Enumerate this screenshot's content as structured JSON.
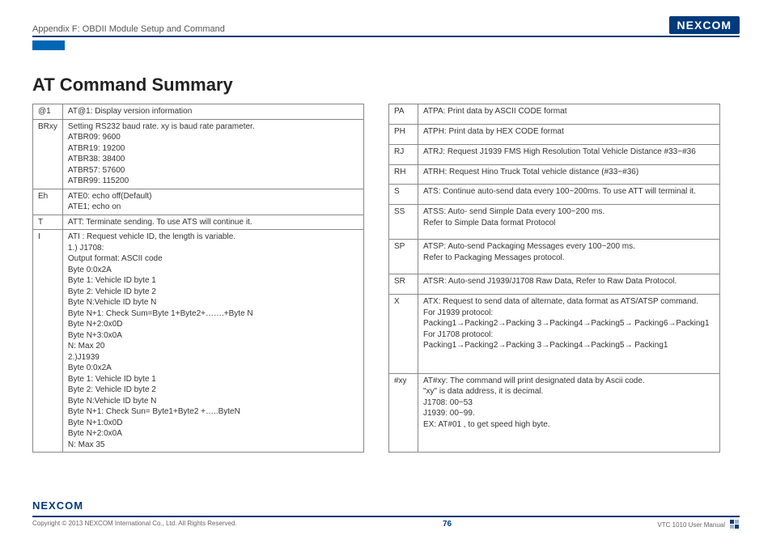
{
  "header": {
    "appendix": "Appendix F: OBDII Module Setup and Command",
    "logo": "NEXCOM"
  },
  "title": "AT Command Summary",
  "table_left": [
    {
      "code": "@1",
      "desc": [
        "AT@1: Display version information"
      ]
    },
    {
      "code": "BRxy",
      "desc": [
        "Setting RS232 baud rate. xy is baud rate parameter.",
        "ATBR09: 9600",
        "ATBR19: 19200",
        "ATBR38: 38400",
        "ATBR57: 57600",
        "ATBR99: 115200"
      ]
    },
    {
      "code": "Eh",
      "desc": [
        "ATE0: echo off(Default)",
        "ATE1; echo on"
      ]
    },
    {
      "code": "T",
      "desc": [
        "ATT: Terminate sending. To use ATS will continue it."
      ]
    },
    {
      "code": "I",
      "desc": [
        "ATI : Request vehicle ID, the length is variable.",
        "1.) J1708:",
        "Output format: ASCII code",
        "Byte 0:0x2A",
        "Byte 1: Vehicle ID byte 1",
        "Byte 2: Vehicle ID byte 2",
        "Byte N:Vehicle ID byte N",
        "Byte N+1: Check Sum=Byte 1+Byte2+…….+Byte N",
        "Byte N+2:0x0D",
        "Byte N+3:0x0A",
        "N: Max 20",
        "2.)J1939",
        "Byte 0:0x2A",
        "Byte 1: Vehicle ID byte 1",
        "Byte 2: Vehicle ID byte 2",
        "Byte N:Vehicle ID byte N",
        "Byte N+1: Check Sun= Byte1+Byte2 +…..ByteN",
        "Byte N+1:0x0D",
        "Byte N+2:0x0A",
        "N: Max 35"
      ]
    }
  ],
  "table_right": [
    {
      "code": "PA",
      "desc": [
        "ATPA: Print data by ASCII CODE format"
      ]
    },
    {
      "code": "PH",
      "desc": [
        "ATPH: Print data by HEX CODE format"
      ]
    },
    {
      "code": "RJ",
      "desc": [
        "ATRJ: Request J1939 FMS High Resolution Total Vehicle Distance #33~#36"
      ]
    },
    {
      "code": "RH",
      "desc": [
        "ATRH: Request Hino Truck Total vehicle distance (#33~#36)"
      ]
    },
    {
      "code": "S",
      "desc": [
        "ATS: Continue auto-send data every 100~200ms. To use ATT will terminal it."
      ]
    },
    {
      "code": "SS",
      "desc": [
        "ATSS: Auto- send Simple Data every 100~200 ms.",
        "Refer to Simple Data format Protocol"
      ]
    },
    {
      "code": "SP",
      "desc": [
        "ATSP: Auto-send Packaging Messages every 100~200 ms.",
        "Refer to Packaging Messages protocol."
      ]
    },
    {
      "code": "SR",
      "desc": [
        "ATSR: Auto-send J1939/J1708 Raw Data, Refer to Raw Data Protocol."
      ]
    },
    {
      "code": "X",
      "desc": [
        "ATX: Request to send data of alternate, data format as ATS/ATSP command.",
        "For J1939 protocol:",
        "Packing1→Packing2→Packing 3→Packing4→Packing5→ Packing6→Packing1",
        "For J1708 protocol:",
        "Packing1→Packing2→Packing 3→Packing4→Packing5→ Packing1"
      ]
    },
    {
      "code": "#xy",
      "desc": [
        "AT#xy: The command will print designated data by Ascii code.",
        "\"xy\" is data address, it is decimal.",
        "J1708: 00~53",
        "J1939: 00~99.",
        "EX: AT#01 , to get speed high byte."
      ]
    }
  ],
  "footer": {
    "logo": "NEXCOM",
    "copyright": "Copyright © 2013 NEXCOM International Co., Ltd. All Rights Reserved.",
    "page": "76",
    "manual": "VTC 1010 User Manual"
  }
}
